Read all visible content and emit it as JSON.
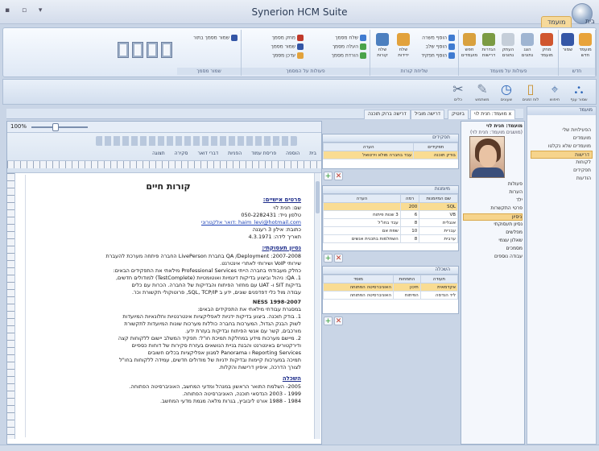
{
  "app": {
    "title": "Synerion HCM Suite",
    "quick_access": "▪ ▫ ▾"
  },
  "ribbon": {
    "tabs": [
      "בית",
      "מועמד"
    ],
    "groups": [
      {
        "label": "חדש",
        "buttons": [
          "שמור",
          "מועמד חדש"
        ]
      },
      {
        "label": "פעולות על מועמד",
        "buttons": [
          "חפש מועמדים",
          "הגדרות דרישות",
          "העתק נתונים",
          "הצג נתונים",
          "מחק מועמד"
        ]
      },
      {
        "label": "שליחת קורות",
        "buttons": [
          "הוסף משרה",
          "הוסף שלב",
          "הוסף תפקיד",
          "הוסף מסמך",
          "שלח ידידות",
          "שלח קורות"
        ]
      },
      {
        "label": "פעולות על המסמך",
        "buttons": [
          "שלח מסמך",
          "העלה מסמך",
          "הורדת מסמך",
          "מחק מסמך",
          "שמור מסמך",
          "עדכן מסמך"
        ]
      },
      {
        "label": "שמור מסמך",
        "buttons": [
          "שמור מסמך בתור"
        ]
      }
    ]
  },
  "band": {
    "items": [
      {
        "label": "שמור ענף",
        "icon": "tree-icon"
      },
      {
        "label": "חיפוש",
        "icon": "pin-icon"
      },
      {
        "label": "לוח זמנים",
        "icon": "calendar-icon"
      },
      {
        "label": "שעונים",
        "icon": "clock-icon"
      },
      {
        "label": "משתמש",
        "icon": "user-icon"
      },
      {
        "label": "כלים",
        "icon": "tools-icon"
      }
    ]
  },
  "nav": {
    "header": "מועמד",
    "items": [
      {
        "label": "הפעילויות שלי",
        "sel": false
      },
      {
        "label": "מועמדים",
        "sel": false
      },
      {
        "label": "מועמדים שלא נקלטו",
        "sel": false
      },
      {
        "label": "דרישות",
        "sel": true
      },
      {
        "label": "לקוחות",
        "sel": false
      },
      {
        "label": "תפקידים",
        "sel": false
      },
      {
        "label": "הודעות",
        "sel": false
      }
    ]
  },
  "doc_tabs": [
    "דרישה ברוק תוכנה",
    "דרישה מוביל",
    "ביוטיק",
    "מועמד: חנית לוי x"
  ],
  "word": {
    "zoom": "100%",
    "menu": [
      "בית",
      "הוספה",
      "פריסת עמוד",
      "הפניות",
      "דברי דואר",
      "סקירה",
      "תצוגה"
    ],
    "title": "קורות חיים",
    "personal": {
      "heading": "פרטים אישיים:",
      "lines": [
        "שם: חנית לוי",
        "טלפון נייד: 050-2282431",
        "haim_levi@hotmail.com :דואר אלקטרוני",
        "כתובת: אילון 3 רעננה",
        "תאריך לידה: 4.3.1971"
      ]
    },
    "experience": {
      "heading": "נסיון תעסוקתי:",
      "lines": [
        "2007-2008: QA /Deployment בחברת LivePerson החברה פיתחה מערכת להעברת",
        "שירותי VoIP ושירותי לאתרי אינטרנט.",
        "כחלק מעבודתי בחברה הייתי Professional Services מילאתי את התפקידים הבאים:",
        "1. QA: ניהול וביצוע בדיקות דינמיות ואוטומטיות (TestComplete) למודולים חדשים,",
        "בדיקות SIT ו- UAT עם מחזור הפיתוח והבדיקות של החברה. הכרות עם כלים",
        "עבודה מול כלי דפדפנים שונים, ידע ב SQL, TCP/IP, פרוטוקולי תקשורת וכו'."
      ],
      "ness_title": "NESS 1998-2007",
      "ness_lines": [
        "במסגרת עבודתי מילאתי את התפקידים הבאים:",
        "1. בודק תוכנה. ביצוע בדיקות ידניות לאפליקציות אינטרנטיות וחלונאיות המיועדות",
        "לשוק הבנק הגדול, המערכות בחברה כוללות מערכות שונות המיועדות לתקשורת",
        "מורכבים, קשר עם אנשי הפיתוח ובדיקות בעזרת ידע.",
        "2. מיישם מערכות מידע במחלקת תמיכת חו\"ל: תפקיד המשלב יישום ללקוחות קצה",
        "ודירקטורים באינטרנט והבנת בניית הנושאים בעזרת סקירות של דוחות כספיים",
        "Reporting Services ו Panorama למגוון אפליקציות בכלים חשובים",
        "תמיכה במערכות קיימות ובדיקות ידניות של מודולים חדשים, עמידה ללקוחות בחו\"ל",
        "לצורך הדרכה, איפיון דרישות והקלות."
      ]
    },
    "education": {
      "heading": "השכלה",
      "lines": [
        "2005- השלמת התואר הראשון במנהל ומדעי המחשב, האוניברסיטה הפתוחה.",
        "1999 - 2003 הנדסאי תוכנה, האוניברסיטה הפתוחה.",
        "1984 - 1988 אורט ליבוביץ, בגרות מלאה מגמת מדעי המחשב."
      ]
    }
  },
  "grids": {
    "jobs": {
      "header": "תפקידים",
      "cols": [
        "תפקידים",
        "הערה"
      ],
      "rows": [
        [
          "בודק תוכנה",
          "עבד בחברה מולא וירטואל"
        ]
      ]
    },
    "skills": {
      "header": "מיומנות",
      "cols": [
        "שם המיומנות",
        "רמה",
        "הערה"
      ],
      "rows": [
        [
          "SQL",
          "200",
          ""
        ],
        [
          "VB",
          "6",
          "3 שנות פיתוח"
        ],
        [
          "אנגלית",
          "8",
          "עבד בחו\"ל"
        ],
        [
          "עברית",
          "10",
          "שפת אם"
        ],
        [
          "ערבית",
          "8",
          "השתלמות בתכנית אנשים"
        ]
      ]
    },
    "education": {
      "header": "השכלה",
      "cols": [
        "תעודה",
        "התמחות",
        "מוסד"
      ],
      "rows": [
        [
          "אקדמאית",
          "תיכון",
          "האוניברסיטה הפתוחה"
        ],
        [
          "ליד הנדסה",
          "הפיתוח",
          "האוניברסיטה הפתוחה"
        ]
      ]
    }
  },
  "info": {
    "header": "מועמד: חנית לוי",
    "sub": "(מושגים  מועמד: חנית לוי)",
    "fields": [
      {
        "label": "פעולות",
        "sel": false
      },
      {
        "label": "הערות",
        "sel": false
      },
      {
        "label": "ילד",
        "sel": false
      },
      {
        "label": "פרטי התקשרות",
        "sel": false
      },
      {
        "label": "ניסיון",
        "sel": true
      },
      {
        "label": "נסיון תעסוקתי",
        "sel": false
      },
      {
        "label": "מפלשים",
        "sel": false
      },
      {
        "label": "שאלון עצמי",
        "sel": false
      },
      {
        "label": "מסמכים",
        "sel": false
      },
      {
        "label": "עבודה נוספים",
        "sel": false
      }
    ]
  }
}
